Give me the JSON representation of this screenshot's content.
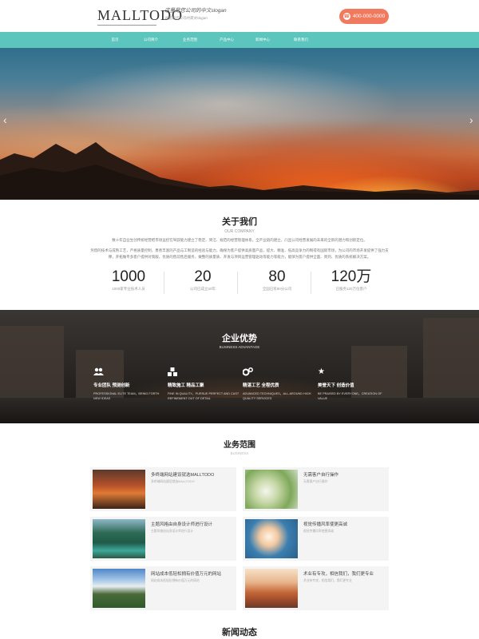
{
  "header": {
    "logo": "MALLTODO",
    "slogan_main": "这里是您公司的中文slogan",
    "slogan_sub": "这里是您公司的英文slogan",
    "phone": "400-000-0000"
  },
  "nav": {
    "items": [
      "首页",
      "公司简介",
      "业务范围",
      "产品中心",
      "新闻中心",
      "联系我们"
    ]
  },
  "banner": {
    "prev_icon": "chevron-left-icon",
    "next_icon": "chevron-right-icon"
  },
  "about": {
    "title": "关于我们",
    "subtitle": "OUR COMPANY",
    "para1": "数十年自业生创传统经营把市场运控在驾驭能力建立了稳定、简洁、规范的经营管理体系，全产业链的建立，凸显公司经营发展的未来的全新的潜力和创新定位。",
    "para2": "凭借的技术与成熟工艺，严格质量控制，勇善丰富的产品与工制造的经验与能力，确保为客户提供高质量产品，提大、精准、低高竞争力的制得有国际市场，为公司的市场开发提供了强力支撑，开拓做专多客户提供对策服，优质的售前售后服务，做整的质量质、开发与项目运营管理驱动等能力等能力，能够为客户提供全面、周到、优质的系统解决方案。",
    "stats": [
      {
        "num": "1000",
        "label": "1000家专业技术人员"
      },
      {
        "num": "20",
        "label": "公司已成立20年"
      },
      {
        "num": "80",
        "label": "全国已有80分公司"
      },
      {
        "num": "120万",
        "label": "已服务120万位客户"
      }
    ]
  },
  "advantage": {
    "title": "企业优势",
    "subtitle": "BUSINESS ADVANTAGE",
    "items": [
      {
        "icon": "users-icon",
        "title": "专业团队 预测创新",
        "desc": "PROFESSIONAL ELITE TEAM，BRING FORTH NEW IDEAS"
      },
      {
        "icon": "cubes-icon",
        "title": "精致施工 精品工聚",
        "desc": "FINE IN QUALITY，PURSUE PERFECT AND CAST REFINEMENT OUT OF DETAIL"
      },
      {
        "icon": "gears-icon",
        "title": "精湛工艺 全程优质",
        "desc": "ADVANCED TECHNIQUES，ALL-AROUND HIGH QUALITY SERVICES"
      },
      {
        "icon": "star-icon",
        "title": "美誉天下 创造价值",
        "desc": "BE PRAISED BY EVERYONE，CREATION OF VALUE"
      }
    ]
  },
  "services": {
    "title": "业务范围",
    "subtitle": "BUSINESS",
    "cards": [
      {
        "title": "多终端网站建设就选MALLTODO",
        "desc": "多终端网站建设就选MALLTODO"
      },
      {
        "title": "无需客户自行操作",
        "desc": "无需客户自行操作"
      },
      {
        "title": "主题风格由自身设计师进行设计",
        "desc": "主题风格由自身设计师进行设计"
      },
      {
        "title": "视觉传播风率使更高诚",
        "desc": "视觉传播风率使更高诚"
      },
      {
        "title": "网站成本低轻松拥有价值万元的网站",
        "desc": "网站成本低轻松拥有价值万元的网站"
      },
      {
        "title": "术业有专攻，相信我们，我们更专业",
        "desc": "术业有专攻，相信我们，我们更专业"
      }
    ]
  },
  "news": {
    "title": "新闻动态"
  }
}
